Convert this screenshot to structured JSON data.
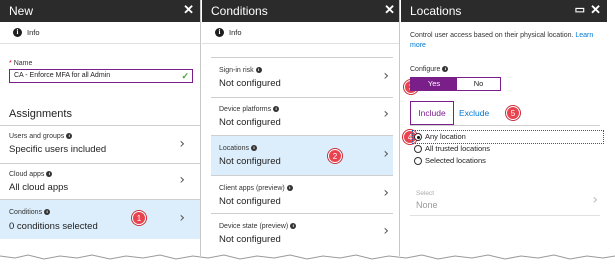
{
  "new_blade": {
    "title": "New",
    "info": "Info",
    "name_label": "Name",
    "name_required": "*",
    "name_value": "CA - Enforce MFA for all Admin",
    "assignments_heading": "Assignments",
    "items": [
      {
        "label": "Users and groups",
        "value": "Specific users included"
      },
      {
        "label": "Cloud apps",
        "value": "All cloud apps"
      },
      {
        "label": "Conditions",
        "value": "0 conditions selected",
        "badge": "1"
      }
    ]
  },
  "conditions_blade": {
    "title": "Conditions",
    "info": "Info",
    "items": [
      {
        "label": "Sign-in risk",
        "value": "Not configured"
      },
      {
        "label": "Device platforms",
        "value": "Not configured"
      },
      {
        "label": "Locations",
        "value": "Not configured",
        "badge": "2"
      },
      {
        "label": "Client apps (preview)",
        "value": "Not configured"
      },
      {
        "label": "Device state (preview)",
        "value": "Not configured"
      }
    ]
  },
  "locations_blade": {
    "title": "Locations",
    "description": "Control user access based on their physical location.",
    "learn_more": "Learn more",
    "configure_label": "Configure",
    "toggle": {
      "yes": "Yes",
      "no": "No",
      "badge": "3"
    },
    "tabs": {
      "include": "Include",
      "exclude": "Exclude",
      "badge": "5"
    },
    "radio": {
      "badge": "4",
      "options": [
        "Any location",
        "All trusted locations",
        "Selected locations"
      ],
      "selected": "Any location"
    },
    "select": {
      "label": "Select",
      "value": "None"
    }
  },
  "colors": {
    "header_bg": "#2b2b2b",
    "accent_purple": "#7a1e8a",
    "link_blue": "#0078d4",
    "selected_row_bg": "#dceefb",
    "badge_red": "#e8434f"
  }
}
